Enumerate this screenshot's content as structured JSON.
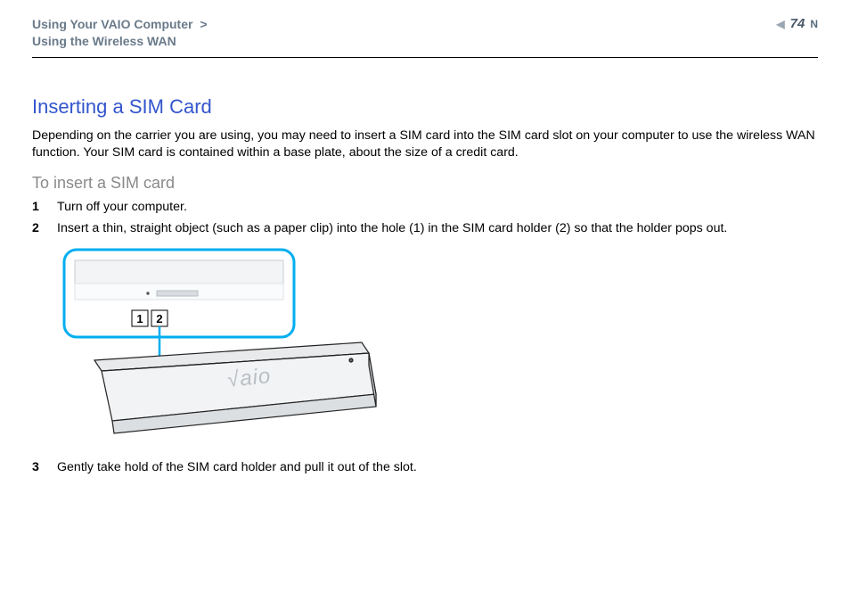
{
  "header": {
    "breadcrumb_line1": "Using Your VAIO Computer",
    "breadcrumb_sep": ">",
    "breadcrumb_line2": "Using the Wireless WAN",
    "page_number": "74",
    "prev_symbol": "◀",
    "next_symbol": "N"
  },
  "section": {
    "title": "Inserting a SIM Card",
    "intro": "Depending on the carrier you are using, you may need to insert a SIM card into the SIM card slot on your computer to use the wireless WAN function. Your SIM card is contained within a base plate, about the size of a credit card.",
    "subtitle": "To insert a SIM card",
    "steps": [
      {
        "n": "1",
        "text": "Turn off your computer."
      },
      {
        "n": "2",
        "text": "Insert a thin, straight object (such as a paper clip) into the hole (1) in the SIM card holder (2) so that the holder pops out."
      },
      {
        "n": "3",
        "text": "Gently take hold of the SIM card holder and pull it out of the slot."
      }
    ],
    "callouts": {
      "one": "1",
      "two": "2"
    }
  }
}
